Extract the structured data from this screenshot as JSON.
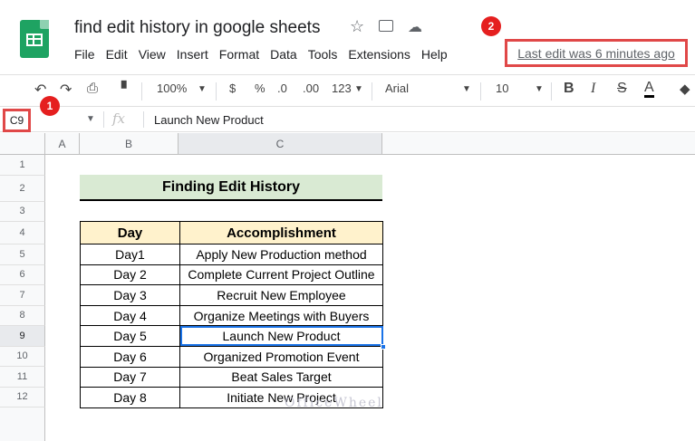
{
  "doc": {
    "title": "find edit history in google sheets"
  },
  "menu": [
    "File",
    "Edit",
    "View",
    "Insert",
    "Format",
    "Data",
    "Tools",
    "Extensions",
    "Help"
  ],
  "last_edit": "Last edit was 6 minutes ago",
  "badges": {
    "one": "1",
    "two": "2"
  },
  "toolbar": {
    "zoom": "100%",
    "currency": "$",
    "percent": "%",
    "dec_less": ".0",
    "dec_more": ".00",
    "more_formats": "123",
    "font": "Arial",
    "font_size": "10",
    "bold": "B",
    "italic": "I",
    "strike": "S",
    "text_color": "A"
  },
  "formula_bar": {
    "name_box": "C9",
    "fx": "fx",
    "value": "Launch New Product"
  },
  "columns": [
    "A",
    "B",
    "C"
  ],
  "rows": [
    "1",
    "2",
    "3",
    "4",
    "5",
    "6",
    "7",
    "8",
    "9",
    "10",
    "11",
    "12"
  ],
  "sheet": {
    "title": "Finding Edit History",
    "headers": {
      "day": "Day",
      "accomplishment": "Accomplishment"
    },
    "entries": [
      {
        "day": "Day1",
        "accomplishment": "Apply New Production method"
      },
      {
        "day": "Day 2",
        "accomplishment": "Complete Current Project Outline"
      },
      {
        "day": "Day 3",
        "accomplishment": "Recruit New Employee"
      },
      {
        "day": "Day 4",
        "accomplishment": "Organize Meetings with Buyers"
      },
      {
        "day": "Day 5",
        "accomplishment": "Launch New Product"
      },
      {
        "day": "Day 6",
        "accomplishment": "Organized Promotion Event"
      },
      {
        "day": "Day 7",
        "accomplishment": "Beat Sales Target"
      },
      {
        "day": "Day 8",
        "accomplishment": "Initiate New Project"
      }
    ]
  },
  "watermark": "OfficeWheel",
  "colors": {
    "highlight": "#e04848",
    "selection": "#1a73e8",
    "title_fill": "#d9ead3",
    "header_fill": "#fff2cc"
  }
}
